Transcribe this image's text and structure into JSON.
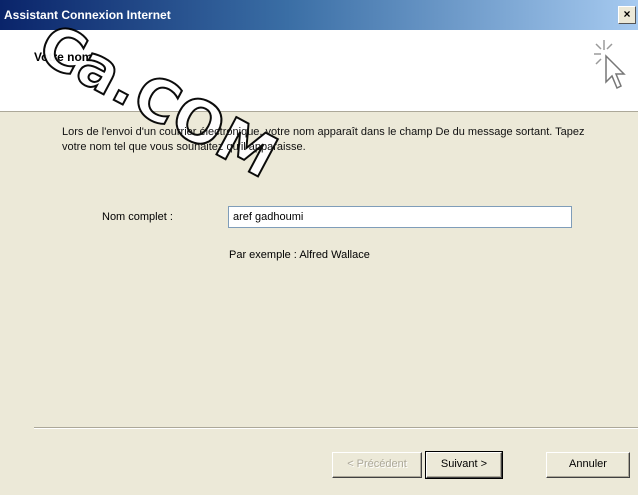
{
  "window": {
    "title": "Assistant Connexion Internet",
    "close_glyph": "×"
  },
  "header": {
    "title": "Votre nom"
  },
  "watermark": {
    "text": "Ca.COM"
  },
  "content": {
    "description": "Lors de l'envoi d'un courrier électronique, votre nom apparaît dans le champ De du message sortant. Tapez votre nom tel que vous souhaitez qu'il apparaisse.",
    "name_label": "Nom complet :",
    "name_value": "aref gadhoumi",
    "example": "Par exemple : Alfred Wallace"
  },
  "buttons": {
    "back": "< Précédent",
    "next": "Suivant >",
    "cancel": "Annuler"
  }
}
